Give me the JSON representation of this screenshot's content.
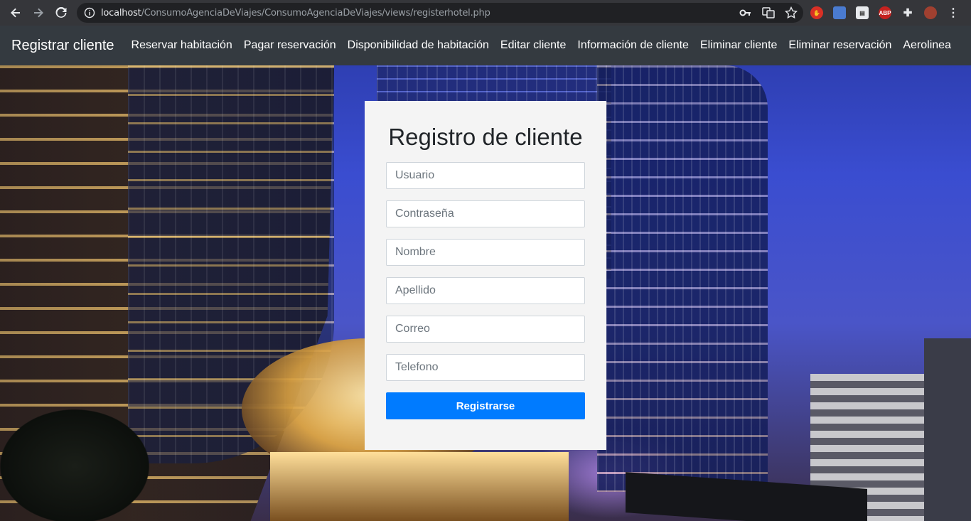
{
  "browser": {
    "url_host": "localhost",
    "url_path": "/ConsumoAgenciaDeViajes/ConsumoAgenciaDeViajes/views/registerhotel.php",
    "extensions": [
      "stop-extension",
      "screen-extension",
      "page-extension",
      "ABP",
      "puzzle-extension",
      "profile-avatar"
    ]
  },
  "navbar": {
    "brand": "Registrar cliente",
    "links": [
      {
        "label": "Reservar habitación"
      },
      {
        "label": "Pagar reservación"
      },
      {
        "label": "Disponibilidad de habitación"
      },
      {
        "label": "Editar cliente"
      },
      {
        "label": "Información de cliente"
      },
      {
        "label": "Eliminar cliente"
      },
      {
        "label": "Eliminar reservación"
      },
      {
        "label": "Aerolinea"
      }
    ]
  },
  "form": {
    "title": "Registro de cliente",
    "fields": [
      {
        "placeholder": "Usuario",
        "value": ""
      },
      {
        "placeholder": "Contraseña",
        "value": ""
      },
      {
        "placeholder": "Nombre",
        "value": ""
      },
      {
        "placeholder": "Apellido",
        "value": ""
      },
      {
        "placeholder": "Correo",
        "value": ""
      },
      {
        "placeholder": "Telefono",
        "value": ""
      }
    ],
    "submit_label": "Registrarse"
  },
  "colors": {
    "navbar_bg": "#343a40",
    "primary": "#007bff",
    "card_bg": "#f4f4f4"
  }
}
